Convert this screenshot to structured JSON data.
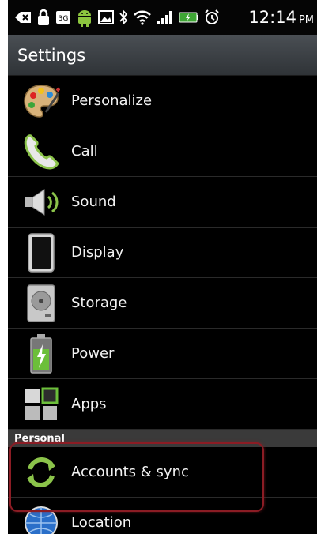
{
  "status_bar": {
    "time": "12:14",
    "ampm": "PM",
    "network_badge": "3G",
    "icons": [
      "back-icon",
      "lock-icon",
      "3g-icon",
      "android-icon",
      "image-icon",
      "bluetooth-icon",
      "wifi-icon",
      "signal-icon",
      "battery-icon",
      "alarm-icon"
    ]
  },
  "titlebar": {
    "title": "Settings"
  },
  "items": [
    {
      "label": "Personalize",
      "icon": "palette-icon"
    },
    {
      "label": "Call",
      "icon": "phone-icon"
    },
    {
      "label": "Sound",
      "icon": "speaker-icon"
    },
    {
      "label": "Display",
      "icon": "display-icon"
    },
    {
      "label": "Storage",
      "icon": "storage-icon"
    },
    {
      "label": "Power",
      "icon": "battery-icon"
    },
    {
      "label": "Apps",
      "icon": "apps-icon"
    }
  ],
  "section": {
    "label": "Personal"
  },
  "personal_items": [
    {
      "label": "Accounts & sync",
      "icon": "sync-icon"
    },
    {
      "label": "Location",
      "icon": "location-icon"
    }
  ],
  "colors": {
    "highlight": "#8b1c24",
    "section_bg": "#3a3a3a"
  }
}
